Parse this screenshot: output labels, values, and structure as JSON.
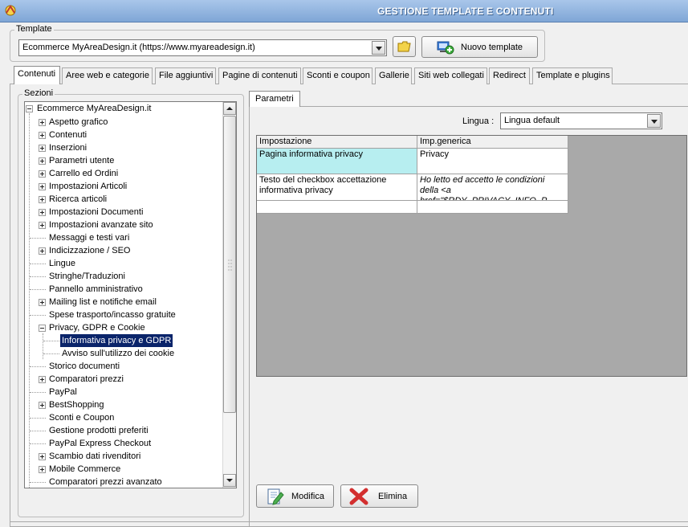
{
  "window": {
    "title": "GESTIONE TEMPLATE E CONTENUTI"
  },
  "template_group": {
    "label": "Template",
    "selected": "Ecommerce MyAreaDesign.it (https://www.myareadesign.it)",
    "new_button": "Nuovo template"
  },
  "tabs": [
    {
      "label": "Contenuti",
      "active": true
    },
    {
      "label": "Aree web e categorie"
    },
    {
      "label": "File aggiuntivi"
    },
    {
      "label": "Pagine di contenuti"
    },
    {
      "label": "Sconti e coupon"
    },
    {
      "label": "Gallerie"
    },
    {
      "label": "Siti web collegati"
    },
    {
      "label": "Redirect"
    },
    {
      "label": "Template e plugins"
    }
  ],
  "sections": {
    "label": "Sezioni",
    "root": "Ecommerce MyAreaDesign.it",
    "items": [
      "Aspetto grafico",
      "Contenuti",
      "Inserzioni",
      "Parametri utente",
      "Carrello ed Ordini",
      "Impostazioni Articoli",
      "Ricerca articoli",
      "Impostazioni Documenti",
      "Impostazioni avanzate sito",
      "Messaggi e testi vari",
      "Indicizzazione / SEO",
      "Lingue",
      "Stringhe/Traduzioni",
      "Pannello amministrativo",
      "Mailing list e notifiche email",
      "Spese trasporto/incasso gratuite",
      "Privacy, GDPR e Cookie",
      "Informativa privacy e GDPR",
      "Avviso sull'utilizzo dei cookie",
      "Storico documenti",
      "Comparatori prezzi",
      "PayPal",
      "BestShopping",
      "Sconti e Coupon",
      "Gestione prodotti preferiti",
      "PayPal Express Checkout",
      "Scambio dati rivenditori",
      "Mobile Commerce",
      "Comparatori prezzi avanzato"
    ]
  },
  "params": {
    "tab": "Parametri",
    "lingua_label": "Lingua :",
    "lingua_value": "Lingua default",
    "columns": [
      "Impostazione",
      "Imp.generica"
    ],
    "rows": [
      [
        "Pagina informativa privacy",
        "Privacy"
      ],
      [
        "Testo del checkbox accettazione informativa privacy",
        "Ho letto ed accetto le condizioni della <a href=\"$RDY_PRIVACY_INFO_P..."
      ]
    ]
  },
  "buttons": {
    "edit": "Modifica",
    "delete": "Elimina"
  }
}
